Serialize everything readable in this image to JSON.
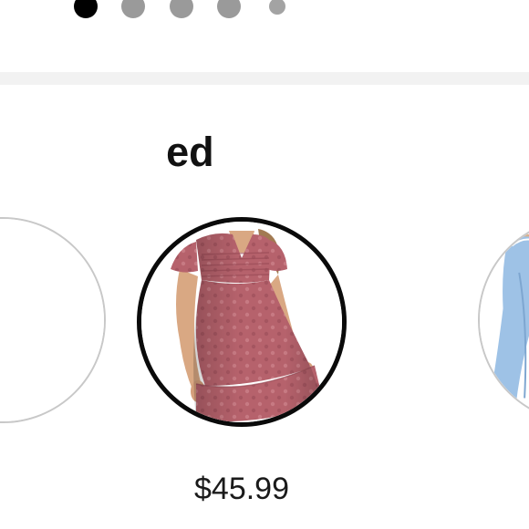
{
  "carousel": {
    "dots": [
      {
        "state": "active"
      },
      {
        "state": "inactive"
      },
      {
        "state": "inactive"
      },
      {
        "state": "inactive"
      },
      {
        "state": "small"
      }
    ]
  },
  "section": {
    "title": "ed"
  },
  "products": [
    {
      "image": "product-thumbnail",
      "price": ""
    },
    {
      "image": "pink-swiss-dot-dress",
      "price": "$45.99",
      "selected": true
    },
    {
      "image": "light-blue-dress",
      "price": ""
    }
  ],
  "colors": {
    "accent": "#000000",
    "dress_pink": "#b5606b",
    "dress_blue": "#9ec2e6",
    "dot_inactive": "#9a9a9a",
    "separator": "#f2f2f2"
  }
}
